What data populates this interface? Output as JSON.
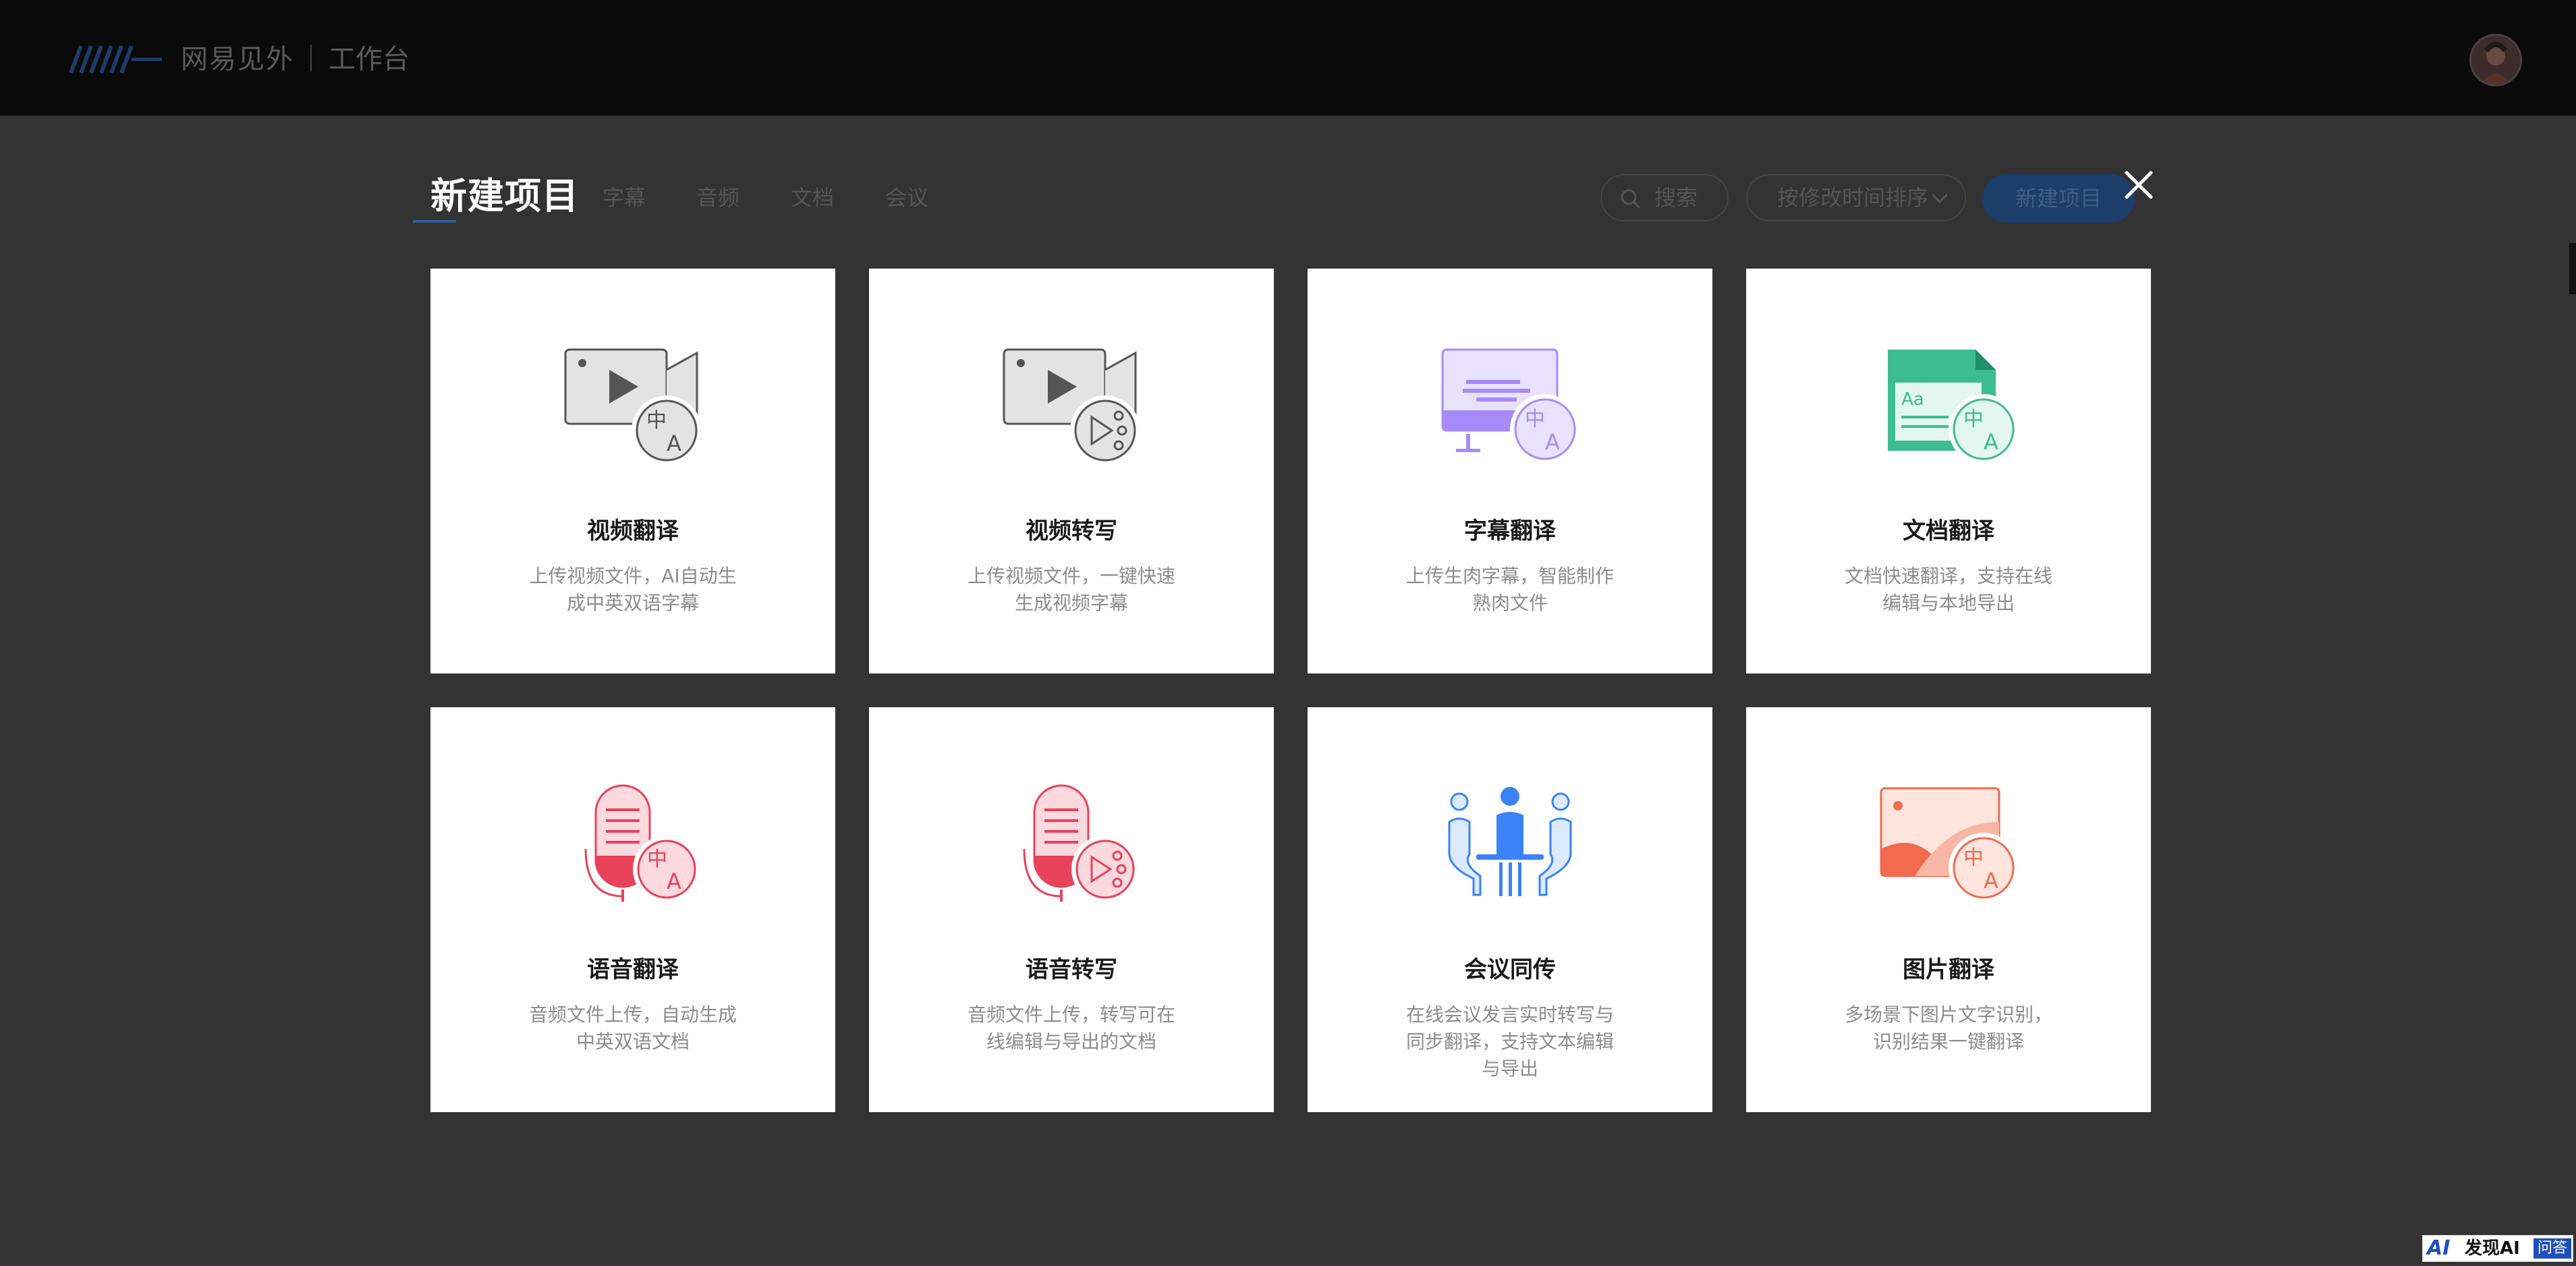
{
  "header": {
    "brand_name": "网易见外",
    "brand_sub": "工作台"
  },
  "underlay": {
    "tabs": [
      "字幕",
      "音频",
      "文档",
      "会议"
    ],
    "search_placeholder": "搜索",
    "sort_label": "按修改时间排序",
    "new_project_button": "新建项目"
  },
  "dialog": {
    "title": "新建项目",
    "cards": [
      {
        "title": "视频翻译",
        "desc": "上传视频文件，AI自动生成中英双语字幕",
        "icon": "video-translate-icon"
      },
      {
        "title": "视频转写",
        "desc": "上传视频文件，一键快速生成视频字幕",
        "icon": "video-transcribe-icon"
      },
      {
        "title": "字幕翻译",
        "desc": "上传生肉字幕，智能制作熟肉文件",
        "icon": "subtitle-translate-icon"
      },
      {
        "title": "文档翻译",
        "desc": "文档快速翻译，支持在线编辑与本地导出",
        "icon": "document-translate-icon"
      },
      {
        "title": "语音翻译",
        "desc": "音频文件上传，自动生成中英双语文档",
        "icon": "audio-translate-icon"
      },
      {
        "title": "语音转写",
        "desc": "音频文件上传，转写可在线编辑与导出的文档",
        "icon": "audio-transcribe-icon"
      },
      {
        "title": "会议同传",
        "desc": "在线会议发言实时转写与同步翻译，支持文本编辑与导出",
        "icon": "meeting-interpret-icon"
      },
      {
        "title": "图片翻译",
        "desc": "多场景下图片文字识别，识别结果一键翻译",
        "icon": "image-translate-icon"
      }
    ]
  },
  "watermark": {
    "ai": "AI",
    "text": "发现AI",
    "qa": "问答"
  },
  "colors": {
    "backdrop": "#333333",
    "topbar": "#0a0a0a",
    "card": "#ffffff",
    "video_icon": "#e3e3e3",
    "subtitle_icon": "#a78bfa",
    "document_icon": "#3dbd8f",
    "audio_icon": "#e8425a",
    "meeting_icon": "#3b82f6",
    "image_icon": "#f26a4f"
  }
}
